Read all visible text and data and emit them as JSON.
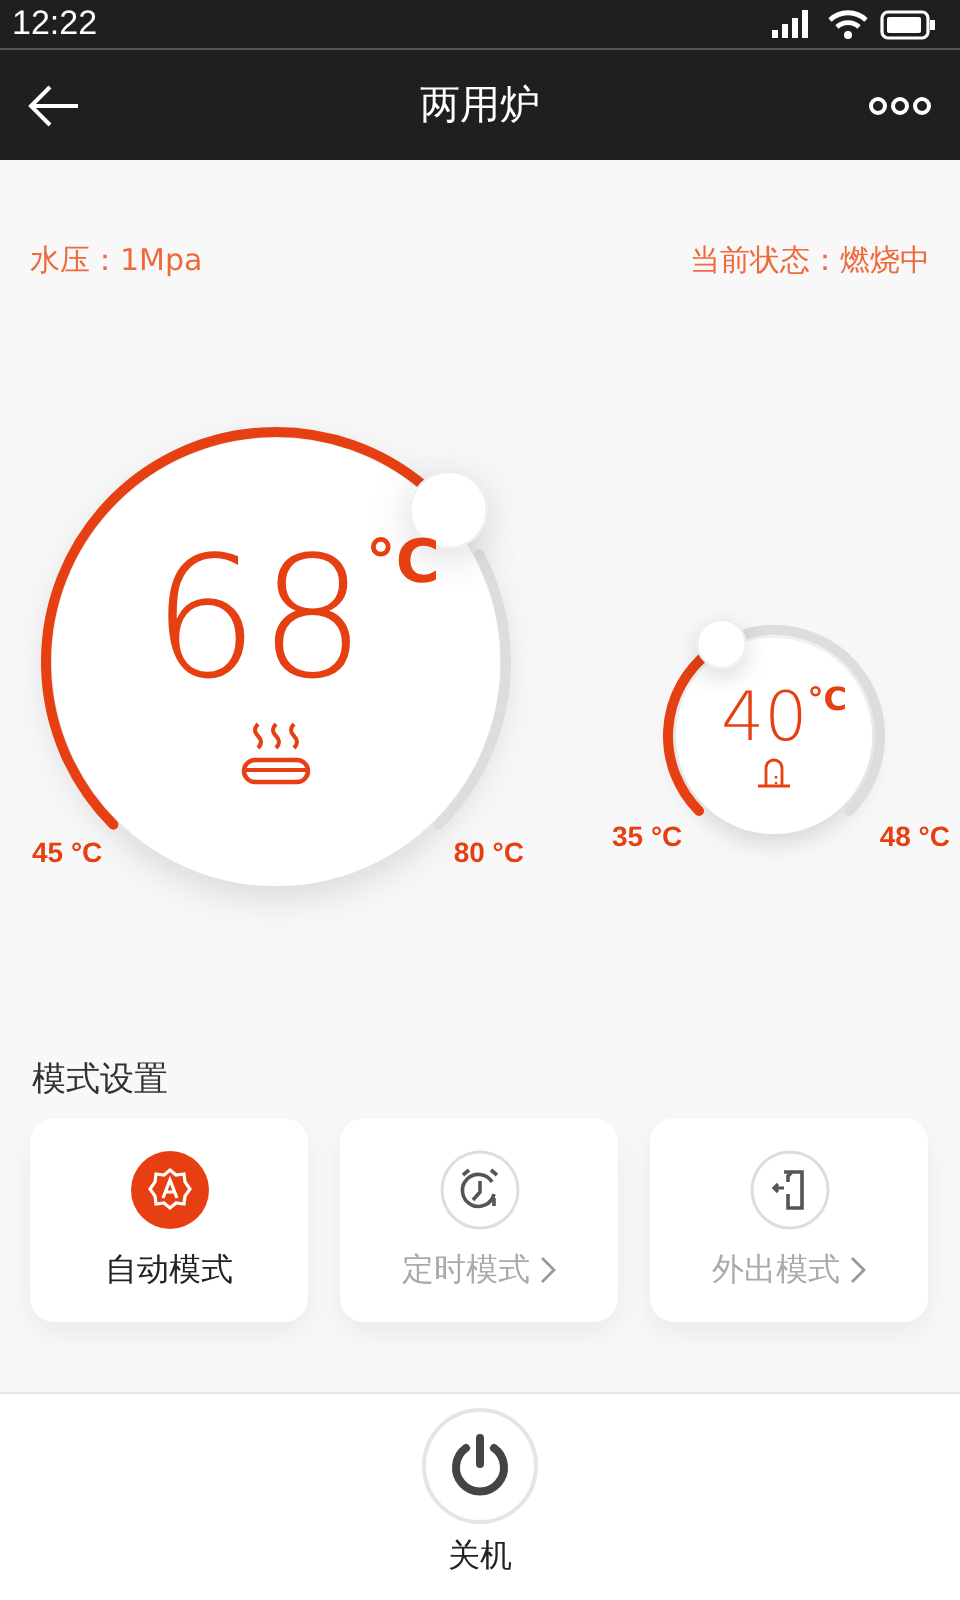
{
  "status_bar": {
    "time": "12:22"
  },
  "header": {
    "title": "两用炉"
  },
  "info": {
    "pressure": "水压：1Mpa",
    "state": "当前状态：燃烧中"
  },
  "dials": [
    {
      "value": "68",
      "unit": "°C",
      "min": "45 °C",
      "max": "80 °C"
    },
    {
      "value": "40",
      "unit": "°C",
      "min": "35 °C",
      "max": "48 °C"
    }
  ],
  "modes": {
    "title": "模式设置",
    "items": [
      {
        "label": "自动模式",
        "selected": true
      },
      {
        "label": "定时模式",
        "selected": false
      },
      {
        "label": "外出模式",
        "selected": false
      }
    ]
  },
  "power": {
    "label": "关机"
  }
}
